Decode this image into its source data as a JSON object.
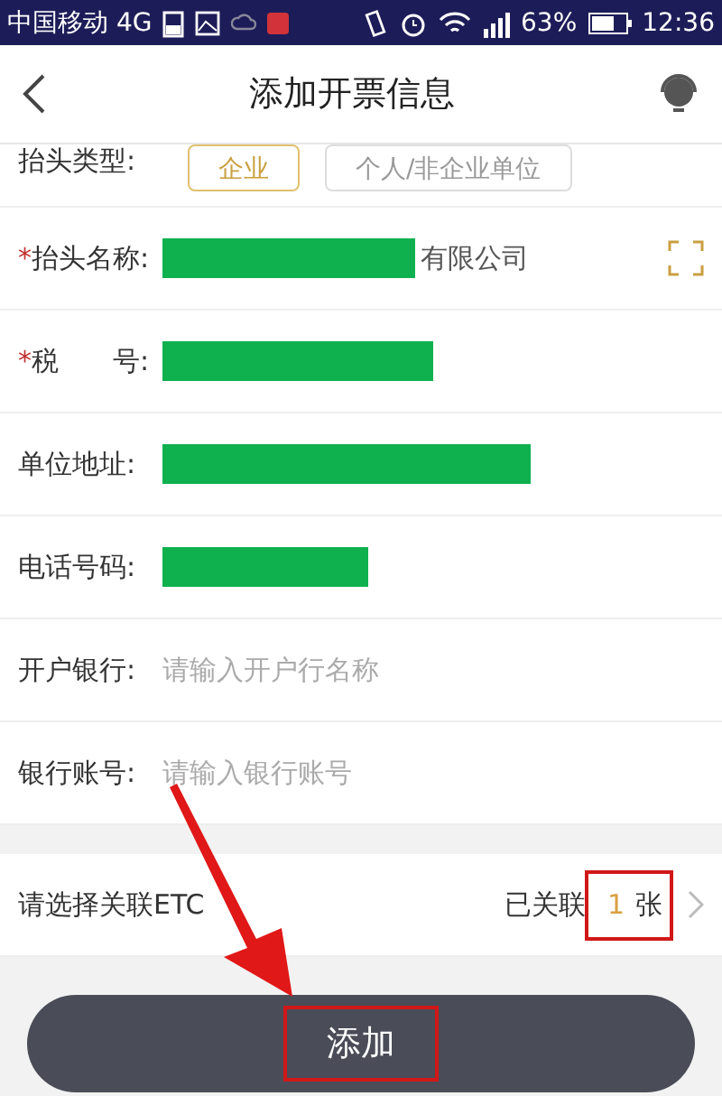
{
  "status_bar": {
    "carrier": "中国移动 4G",
    "battery": "63%",
    "time": "12:36"
  },
  "header": {
    "title": "添加开票信息"
  },
  "title_type": {
    "label": "抬头类型:",
    "options": [
      {
        "label": "企业",
        "selected": true
      },
      {
        "label": "个人/非企业单位",
        "selected": false
      }
    ]
  },
  "fields": [
    {
      "label": "抬头名称:",
      "required_mark": "*",
      "kind": "redacted",
      "value": "有限公司",
      "scan": true
    },
    {
      "label": "税　　号:",
      "required_mark": "*",
      "kind": "redacted"
    },
    {
      "label": "单位地址:",
      "kind": "redacted"
    },
    {
      "label": "电话号码:",
      "kind": "redacted"
    },
    {
      "label": "开户银行:",
      "kind": "input",
      "placeholder": "请输入开户行名称"
    },
    {
      "label": "银行账号:",
      "kind": "input",
      "placeholder": "请输入银行账号"
    }
  ],
  "etc": {
    "label": "请选择关联ETC",
    "linked_prefix": "已关联",
    "count": "1",
    "unit": "张"
  },
  "add_button": {
    "label": "添加"
  }
}
